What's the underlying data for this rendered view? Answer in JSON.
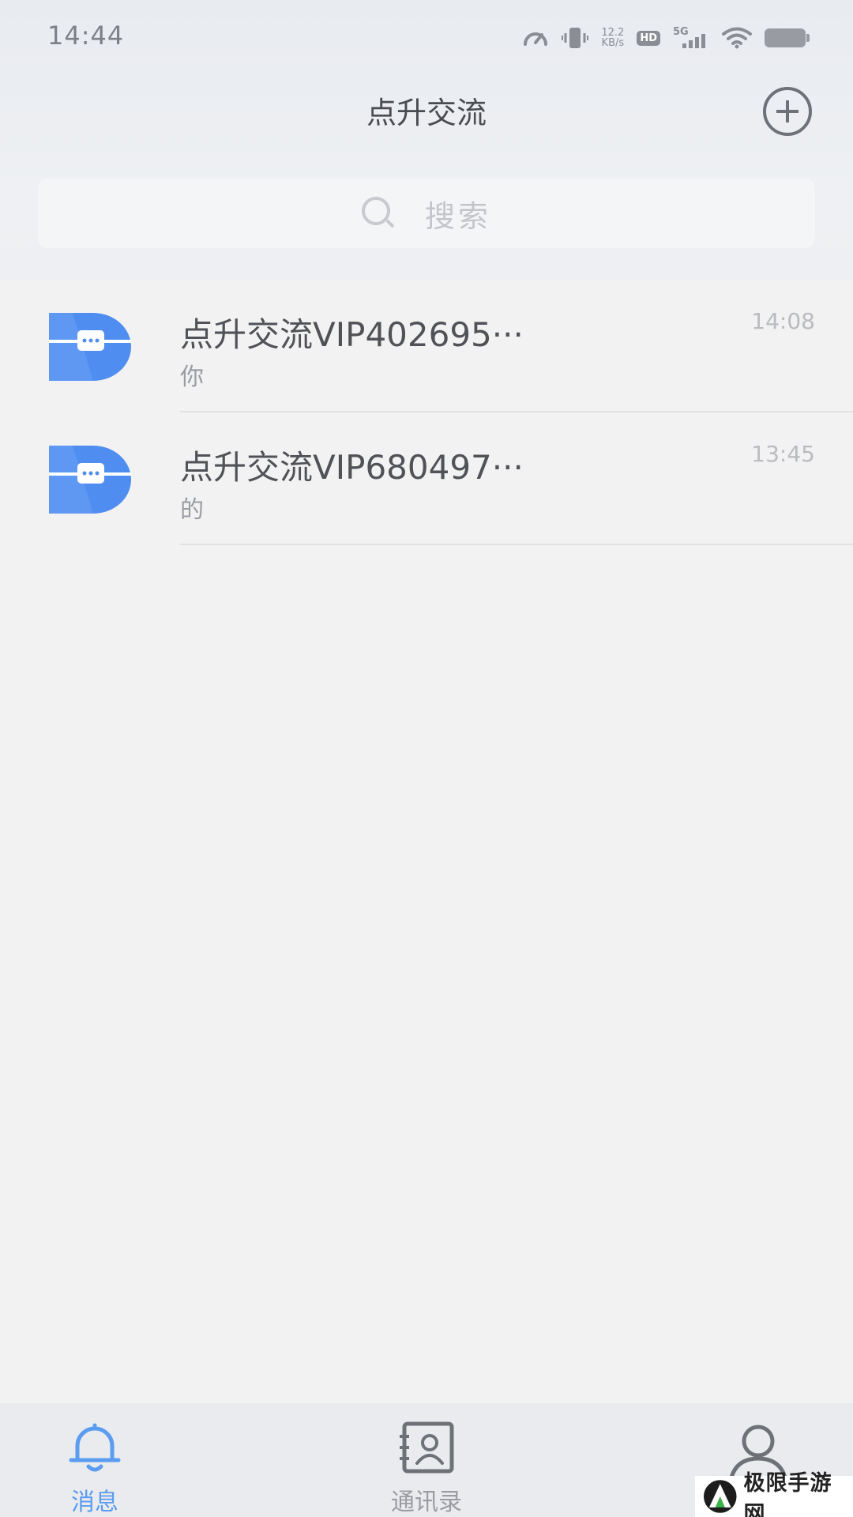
{
  "status_bar": {
    "time": "14:44",
    "net_speed_value": "12.2",
    "net_speed_unit": "KB/s",
    "hd_label": "HD",
    "network_label": "5G",
    "icons": [
      "speedometer-icon",
      "vibrate-icon",
      "signal-icon",
      "wifi-icon",
      "battery-icon"
    ]
  },
  "header": {
    "title": "点升交流",
    "add_icon": "plus-circle-icon"
  },
  "search": {
    "placeholder": "搜索",
    "icon": "search-icon"
  },
  "conversations": [
    {
      "name": "点升交流VIP402695···",
      "last_message": "你",
      "time": "14:08"
    },
    {
      "name": "点升交流VIP680497···",
      "last_message": "的",
      "time": "13:45"
    }
  ],
  "tabbar": {
    "tabs": [
      {
        "label": "消息",
        "icon": "bell-icon",
        "active": true
      },
      {
        "label": "通讯录",
        "icon": "contacts-icon",
        "active": false
      },
      {
        "label": "",
        "icon": "person-icon",
        "active": false
      }
    ]
  },
  "watermark": {
    "text": "极限手游网"
  },
  "colors": {
    "accent": "#5b9cf0",
    "avatar_blue": "#4f8df0",
    "background": "#f2f2f3"
  }
}
